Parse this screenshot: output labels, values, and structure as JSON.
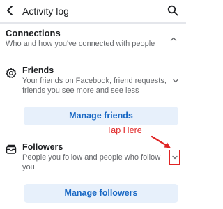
{
  "header": {
    "title": "Activity log",
    "back_icon": "arrow-left-icon",
    "search_icon": "search-icon"
  },
  "section": {
    "title": "Connections",
    "subtitle": "Who and how you've connected with people",
    "expanded": true
  },
  "items": [
    {
      "title": "Friends",
      "description": "Your friends on Facebook, friend requests, friends you see more and see less",
      "icon": "gear-icon",
      "button_label": "Manage friends"
    },
    {
      "title": "Followers",
      "description": "People you follow and people who follow you",
      "icon": "followers-box-icon",
      "button_label": "Manage followers"
    }
  ],
  "annotation": {
    "text": "Tap Here",
    "color": "#e02424"
  },
  "colors": {
    "button_bg": "#e7f0fb",
    "button_text": "#1968c4",
    "secondary_text": "#65676b"
  }
}
